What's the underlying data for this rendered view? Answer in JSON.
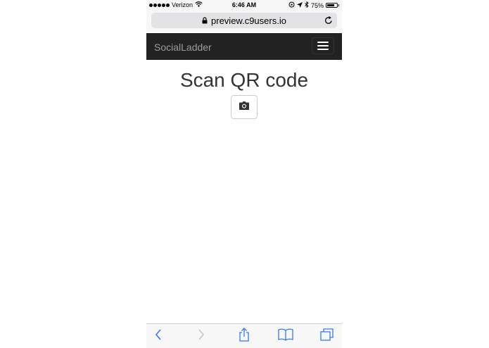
{
  "status_bar": {
    "carrier": "Verizon",
    "time": "6:46 AM",
    "battery_percent": "75%",
    "battery_level": 0.75
  },
  "browser": {
    "url": "preview.c9users.io"
  },
  "navbar": {
    "brand": "SocialLadder"
  },
  "main": {
    "title": "Scan QR code"
  },
  "icons": {
    "signal": "signal-dots-icon",
    "wifi": "wifi-icon",
    "lock": "lock-icon",
    "reload": "reload-icon",
    "menu": "hamburger-icon",
    "camera": "camera-icon",
    "back": "back-chevron-icon",
    "forward": "forward-chevron-icon",
    "share": "share-icon",
    "bookmarks": "bookmarks-icon",
    "tabs": "tabs-icon"
  },
  "colors": {
    "navbar_bg": "#222222",
    "brand_text": "#9d9d9d",
    "ios_blue": "#3478f6"
  }
}
